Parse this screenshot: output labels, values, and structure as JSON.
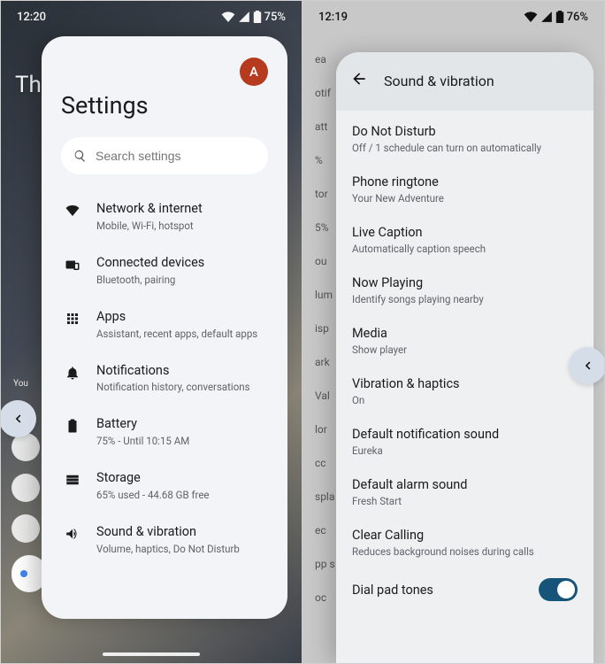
{
  "left": {
    "status": {
      "time": "12:20",
      "battery": "75%"
    },
    "wallpaper_text": "Th",
    "bg_you_label": "You",
    "avatar_initial": "A",
    "page_title": "Settings",
    "search_placeholder": "Search settings",
    "items": [
      {
        "icon": "wifi-icon",
        "title": "Network & internet",
        "sub": "Mobile, Wi-Fi, hotspot"
      },
      {
        "icon": "devices-icon",
        "title": "Connected devices",
        "sub": "Bluetooth, pairing"
      },
      {
        "icon": "apps-icon",
        "title": "Apps",
        "sub": "Assistant, recent apps, default apps"
      },
      {
        "icon": "bell-icon",
        "title": "Notifications",
        "sub": "Notification history, conversations"
      },
      {
        "icon": "battery-icon",
        "title": "Battery",
        "sub": "75% - Until 10:15 AM"
      },
      {
        "icon": "storage-icon",
        "title": "Storage",
        "sub": "65% used - 44.68 GB free"
      },
      {
        "icon": "sound-icon",
        "title": "Sound & vibration",
        "sub": "Volume, haptics, Do Not Disturb"
      }
    ]
  },
  "right": {
    "status": {
      "time": "12:19",
      "battery": "76%"
    },
    "bg_items": [
      "ea",
      "otif",
      "att",
      "%",
      "tor",
      "5%",
      "ou",
      "lum",
      "isp",
      "ark",
      "Val",
      "lor",
      "cc",
      "spla",
      "ec",
      "pp s",
      "oc"
    ],
    "header_title": "Sound & vibration",
    "items": [
      {
        "title": "Do Not Disturb",
        "sub": "Off / 1 schedule can turn on automatically"
      },
      {
        "title": "Phone ringtone",
        "sub": "Your New Adventure"
      },
      {
        "title": "Live Caption",
        "sub": "Automatically caption speech"
      },
      {
        "title": "Now Playing",
        "sub": "Identify songs playing nearby"
      },
      {
        "title": "Media",
        "sub": "Show player"
      },
      {
        "title": "Vibration & haptics",
        "sub": "On"
      },
      {
        "title": "Default notification sound",
        "sub": "Eureka"
      },
      {
        "title": "Default alarm sound",
        "sub": "Fresh Start"
      },
      {
        "title": "Clear Calling",
        "sub": "Reduces background noises during calls"
      }
    ],
    "toggle_item": {
      "title": "Dial pad tones",
      "on": true
    }
  }
}
